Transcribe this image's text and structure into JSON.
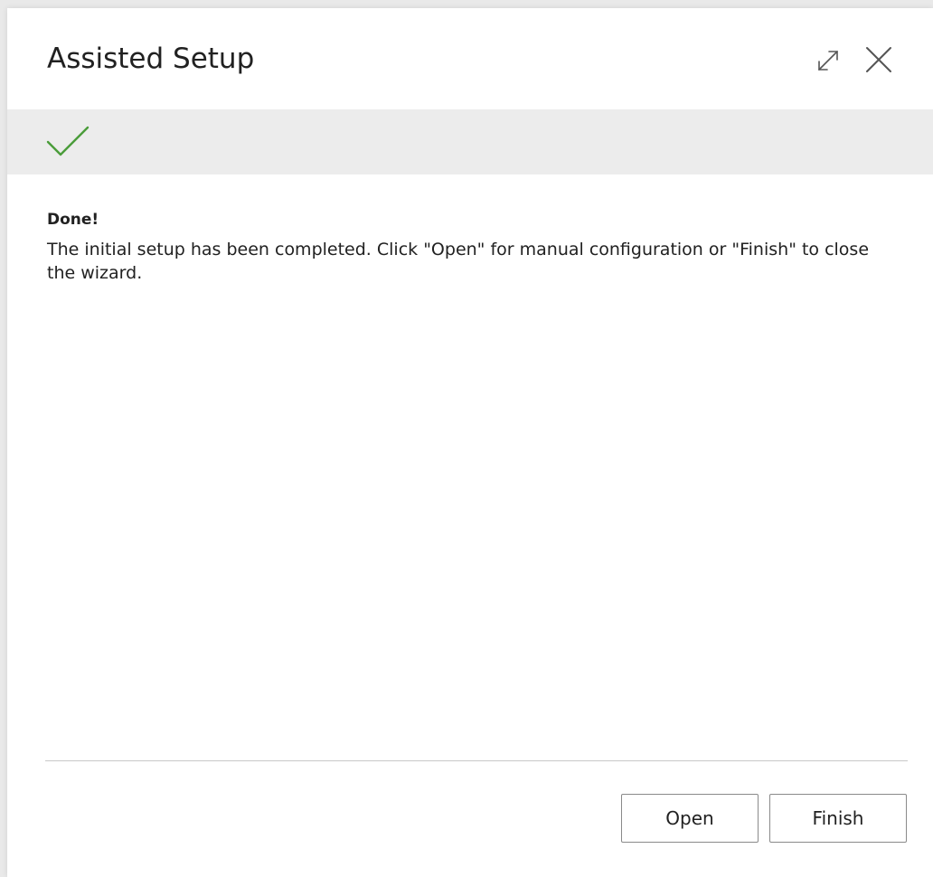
{
  "dialog": {
    "title": "Assisted Setup",
    "expand_icon": "expand-diagonal-icon",
    "close_icon": "close-icon"
  },
  "step_bar": {
    "status_icon": "checkmark-icon",
    "status_color": "#4a9c3a"
  },
  "content": {
    "heading": "Done!",
    "message": "The initial setup has been completed. Click \"Open\" for manual configuration or \"Finish\" to close the wizard."
  },
  "footer": {
    "open_label": "Open",
    "finish_label": "Finish"
  }
}
